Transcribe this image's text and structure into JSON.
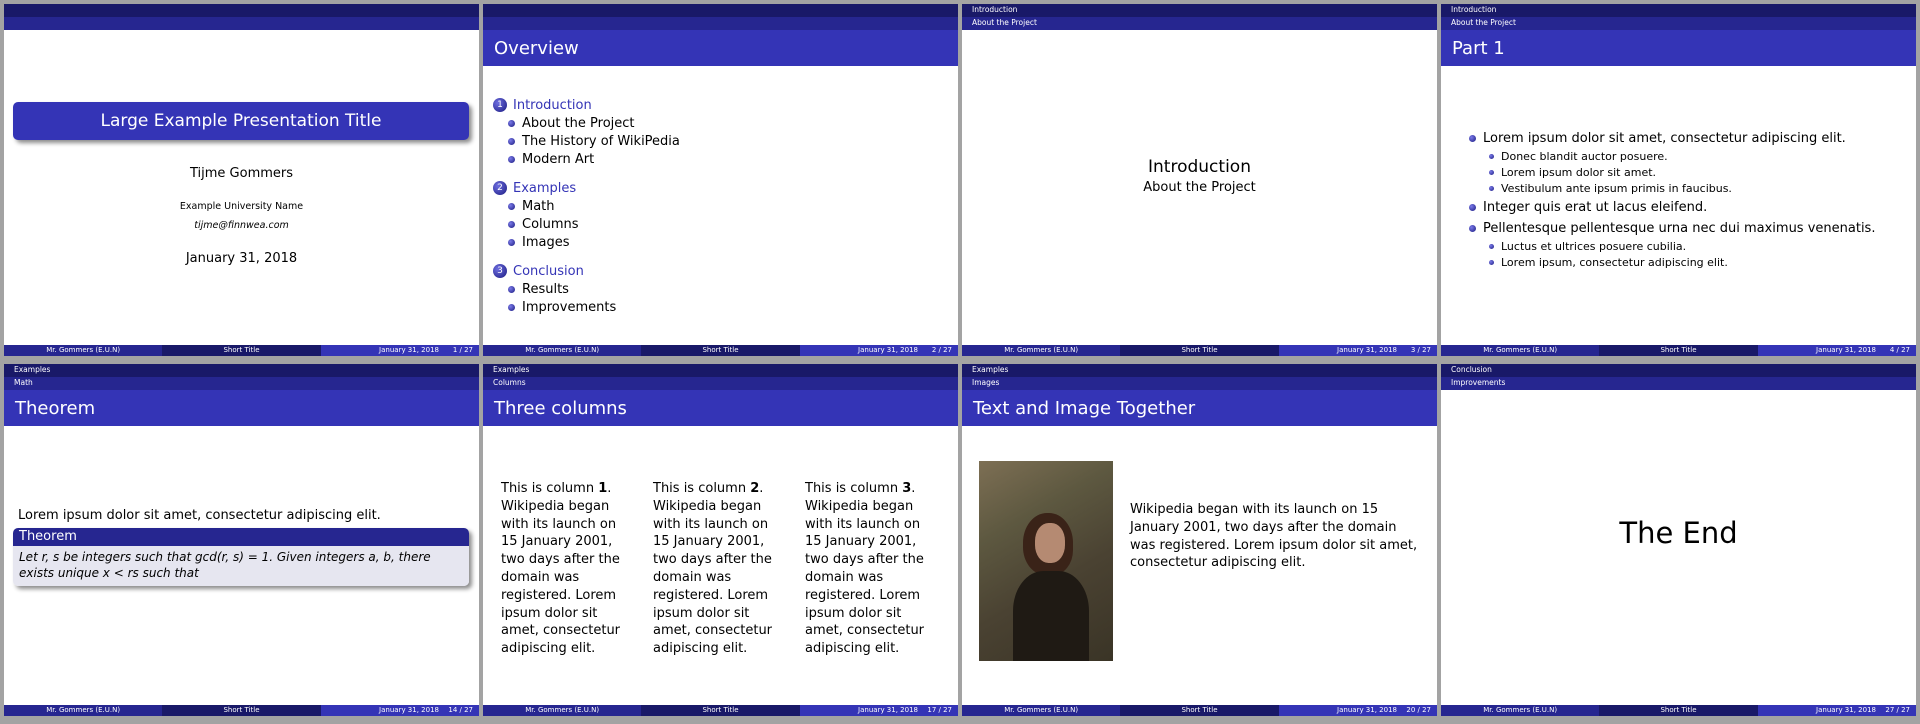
{
  "footer": {
    "author": "Mr. Gommers  (E.U.N)",
    "short_title": "Short Title",
    "date": "January 31, 2018",
    "total": "27"
  },
  "slides": [
    {
      "page": "1 / 27",
      "title": "Large Example Presentation Title",
      "author": "Tijme Gommers",
      "institute": "Example University Name",
      "email": "tijme@finnwea.com",
      "date": "January 31, 2018"
    },
    {
      "page": "2 / 27",
      "frame_title": "Overview",
      "toc": [
        {
          "num": "1",
          "label": "Introduction",
          "subs": [
            "About the Project",
            "The History of WikiPedia",
            "Modern Art"
          ]
        },
        {
          "num": "2",
          "label": "Examples",
          "subs": [
            "Math",
            "Columns",
            "Images"
          ]
        },
        {
          "num": "3",
          "label": "Conclusion",
          "subs": [
            "Results",
            "Improvements"
          ]
        }
      ]
    },
    {
      "page": "3 / 27",
      "section": "Introduction",
      "subsection": "About the Project",
      "big": "Introduction",
      "small": "About the Project"
    },
    {
      "page": "4 / 27",
      "section": "Introduction",
      "subsection": "About the Project",
      "frame_title": "Part 1",
      "items": [
        {
          "text": "Lorem ipsum dolor sit amet, consectetur adipiscing elit.",
          "subs": [
            "Donec blandit auctor posuere.",
            "Lorem ipsum dolor sit amet.",
            "Vestibulum ante ipsum primis in faucibus."
          ]
        },
        {
          "text": "Integer quis erat ut lacus eleifend.",
          "subs": []
        },
        {
          "text": "Pellentesque pellentesque urna nec dui maximus venenatis.",
          "subs": [
            "Luctus et ultrices posuere cubilia.",
            "Lorem ipsum, consectetur adipiscing elit."
          ]
        }
      ]
    },
    {
      "page": "14 / 27",
      "section": "Examples",
      "subsection": "Math",
      "frame_title": "Theorem",
      "text": "Lorem ipsum dolor sit amet, consectetur adipiscing elit.",
      "block_title": "Theorem",
      "block_body": "Let r, s be integers such that gcd(r, s) = 1. Given integers a, b, there exists unique x < rs such that"
    },
    {
      "page": "17 / 27",
      "section": "Examples",
      "subsection": "Columns",
      "frame_title": "Three columns",
      "columns": [
        {
          "prefix": "This is column ",
          "num": "1",
          "suffix": ".",
          "body": "Wikipedia began with its launch on 15 January 2001, two days after the domain was registered. Lorem ipsum dolor sit amet, consectetur adipiscing elit."
        },
        {
          "prefix": "This is column ",
          "num": "2",
          "suffix": ".",
          "body": "Wikipedia began with its launch on 15 January 2001, two days after the domain was registered. Lorem ipsum dolor sit amet, consectetur adipiscing elit."
        },
        {
          "prefix": "This is column ",
          "num": "3",
          "suffix": ".",
          "body": "Wikipedia began with its launch on 15 January 2001, two days after the domain was registered. Lorem ipsum dolor sit amet, consectetur adipiscing elit."
        }
      ]
    },
    {
      "page": "20 / 27",
      "section": "Examples",
      "subsection": "Images",
      "frame_title": "Text and Image Together",
      "text": "Wikipedia began with its launch on 15 January 2001, two days after the domain was registered. Lorem ipsum dolor sit amet, consectetur adipiscing elit."
    },
    {
      "page": "27 / 27",
      "section": "Conclusion",
      "subsection": "Improvements",
      "big": "The End"
    }
  ],
  "colors": {
    "dark": "#191968",
    "mid": "#262690",
    "accent": "#3434b6",
    "block_bg": "#e6e6f0"
  }
}
